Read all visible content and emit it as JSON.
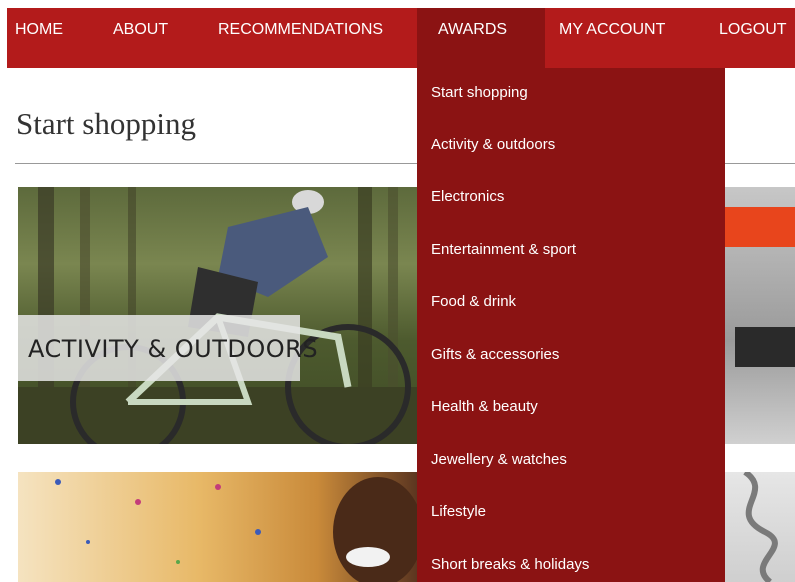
{
  "nav": {
    "home": "HOME",
    "about": "ABOUT",
    "recommendations": "RECOMMENDATIONS",
    "awards": "AWARDS",
    "my_account": "MY ACCOUNT",
    "logout": "LOGOUT"
  },
  "dropdown": {
    "items": [
      "Start shopping",
      "Activity & outdoors",
      "Electronics",
      "Entertainment & sport",
      "Food & drink",
      "Gifts & accessories",
      "Health & beauty",
      "Jewellery & watches",
      "Lifestyle",
      "Short breaks & holidays"
    ]
  },
  "page": {
    "title": "Start shopping"
  },
  "tiles": {
    "activity_label": "ACTIVITY & OUTDOORS"
  },
  "colors": {
    "nav_bg": "#b31b1b",
    "nav_active_bg": "#8b1313",
    "dropdown_bg": "#8b1313"
  }
}
